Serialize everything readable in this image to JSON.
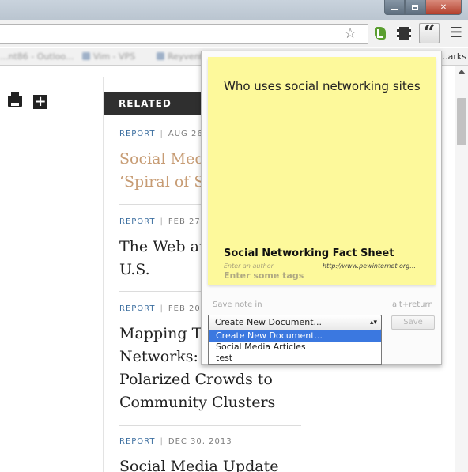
{
  "browser": {
    "bookmarks": [
      {
        "label": "...nt86 - Outloo..."
      },
      {
        "label": "Vim - VPS"
      },
      {
        "label": "Reyvent..."
      }
    ],
    "bookmarks_other": "...arks"
  },
  "page": {
    "related_header": "RELATED",
    "articles": [
      {
        "type": "REPORT",
        "date": "AUG 26",
        "headline": "Social Medi\n‘Spiral of Si",
        "visited": true
      },
      {
        "type": "REPORT",
        "date": "FEB 27",
        "headline": "The Web at\nU.S.",
        "visited": false
      },
      {
        "type": "REPORT",
        "date": "FEB 20",
        "headline": "Mapping Tv\nNetworks: \nPolarized Crowds to\nCommunity Clusters",
        "visited": false
      },
      {
        "type": "REPORT",
        "date": "DEC 30, 2013",
        "headline": "Social Media Update",
        "visited": false
      }
    ]
  },
  "popup": {
    "note_text": "Who uses social networking sites",
    "note_title": "Social Networking Fact Sheet",
    "author_placeholder": "Enter an author",
    "source_url": "http://www.pewinternet.org...",
    "tags_placeholder": "Enter some tags",
    "save_note_in_label": "Save note in",
    "shortcut_hint": "alt+return",
    "selected_option": "Create New Document...",
    "options": [
      "Create New Document...",
      "Social Media Articles",
      "test"
    ],
    "save_button": "Save"
  },
  "colors": {
    "sticky_note": "#fdf99b",
    "related_bar": "#2f2f2f",
    "report_label": "#3d6fa0",
    "visited_headline": "#c79c74",
    "dropdown_highlight": "#3b78e0"
  }
}
